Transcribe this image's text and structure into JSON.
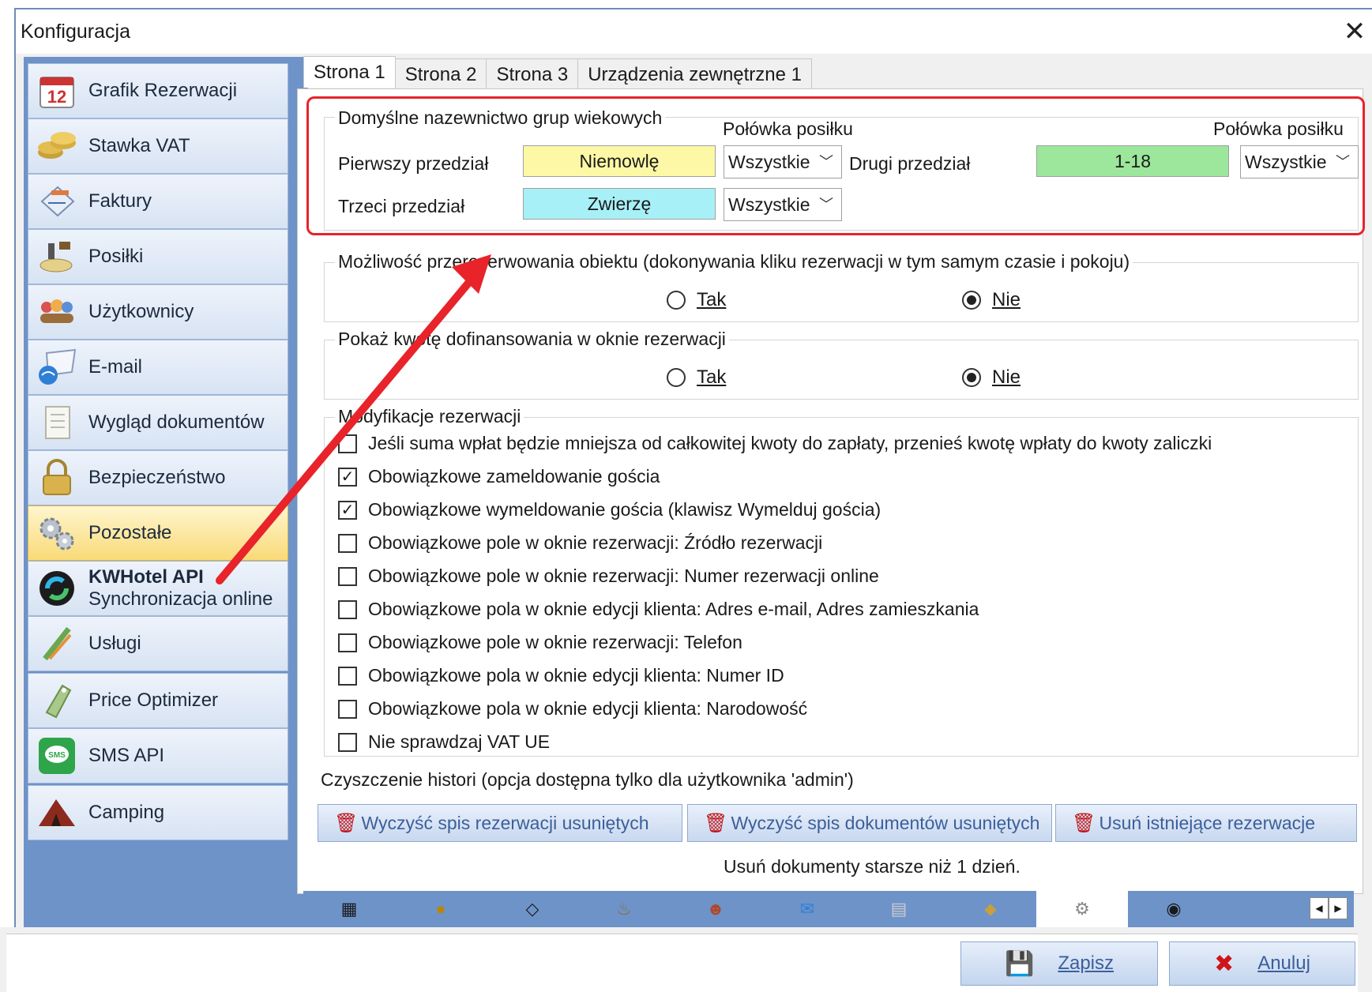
{
  "window": {
    "title": "Konfiguracja",
    "close_glyph": "✕"
  },
  "sidebar": {
    "items": [
      {
        "label": "Grafik Rezerwacji",
        "icon": "calendar-icon"
      },
      {
        "label": "Stawka VAT",
        "icon": "coins-icon"
      },
      {
        "label": "Faktury",
        "icon": "invoice-icon"
      },
      {
        "label": "Posiłki",
        "icon": "meals-icon"
      },
      {
        "label": "Użytkownicy",
        "icon": "users-icon"
      },
      {
        "label": "E-mail",
        "icon": "email-icon"
      },
      {
        "label": "Wygląd dokumentów",
        "icon": "document-icon"
      },
      {
        "label": "Bezpieczeństwo",
        "icon": "lock-icon"
      },
      {
        "label": "Pozostałe",
        "icon": "gears-icon"
      },
      {
        "label": "KWHotel API",
        "sublabel": "Synchronizacja online",
        "icon": "api-icon"
      },
      {
        "label": "Usługi",
        "icon": "services-icon"
      },
      {
        "label": "Price Optimizer",
        "icon": "price-icon"
      },
      {
        "label": "SMS API",
        "icon": "sms-icon"
      },
      {
        "label": "Camping",
        "icon": "camping-icon"
      }
    ],
    "calendar_number": "12",
    "sms_text": "SMS"
  },
  "tabs": [
    "Strona 1",
    "Strona 2",
    "Strona 3",
    "Urządzenia zewnętrzne 1"
  ],
  "age_groups": {
    "title": "Domyślne nazewnictwo grup wiekowych",
    "meal_half_label_1": "Połówka posiłku",
    "meal_half_label_2": "Połówka posiłku",
    "first_label": "Pierwszy przedział",
    "first_value": "Niemowlę",
    "first_select": "Wszystkie",
    "second_label": "Drugi przedział",
    "second_value": "1-18",
    "second_select": "Wszystkie",
    "third_label": "Trzeci przedział",
    "third_value": "Zwierzę",
    "third_select": "Wszystkie"
  },
  "overbooking": {
    "title": "Możliwość przerezerwowania obiektu (dokonywania kliku rezerwacji w tym samym czasie i pokoju)",
    "yes": "Tak",
    "no": "Nie",
    "selected": "no"
  },
  "subsidy": {
    "title": "Pokaż kwotę dofinansowania w oknie rezerwacji",
    "yes": "Tak",
    "no": "Nie",
    "selected": "no"
  },
  "modifications": {
    "title": "Modyfikacje rezerwacji",
    "items": [
      {
        "label": "Jeśli suma wpłat będzie mniejsza od całkowitej kwoty do zapłaty, przenieś kwotę wpłaty do kwoty zaliczki",
        "checked": false
      },
      {
        "label": "Obowiązkowe zameldowanie gościa",
        "checked": true
      },
      {
        "label": "Obowiązkowe wymeldowanie gościa (klawisz Wymelduj gościa)",
        "checked": true
      },
      {
        "label": "Obowiązkowe pole w oknie rezerwacji: Źródło rezerwacji",
        "checked": false
      },
      {
        "label": "Obowiązkowe pole w oknie rezerwacji: Numer rezerwacji online",
        "checked": false
      },
      {
        "label": "Obowiązkowe pola w oknie edycji klienta: Adres e-mail, Adres zamieszkania",
        "checked": false
      },
      {
        "label": "Obowiązkowe pole w oknie rezerwacji:  Telefon",
        "checked": false
      },
      {
        "label": "Obowiązkowe pola w oknie edycji klienta: Numer ID",
        "checked": false
      },
      {
        "label": "Obowiązkowe pola w oknie edycji klienta: Narodowość",
        "checked": false
      },
      {
        "label": "Nie sprawdzaj VAT UE",
        "checked": false
      }
    ],
    "check_glyph": "✓"
  },
  "history": {
    "title": "Czyszczenie histori (opcja dostępna tylko dla użytkownika 'admin')",
    "btn1": "Wyczyść spis rezerwacji usuniętych",
    "btn2": "Wyczyść spis dokumentów usuniętych",
    "btn3": "Usuń istniejące rezerwacje",
    "note": "Usuń dokumenty starsze niż 1 dzień."
  },
  "icon_strip": [
    "calendar-icon",
    "coins-icon",
    "invoice-icon",
    "meals-icon",
    "users-icon",
    "email-icon",
    "document-icon",
    "lock-icon",
    "gears-icon",
    "api-icon"
  ],
  "footer": {
    "save": "Zapisz",
    "cancel": "Anuluj"
  },
  "colors": {
    "first_bg": "#fdf8a6",
    "second_bg": "#9ce79b",
    "third_bg": "#a8f0f8",
    "annotation": "#e8232a",
    "sidebar_bg": "#6e93c9",
    "active_item": "#f9da78"
  }
}
